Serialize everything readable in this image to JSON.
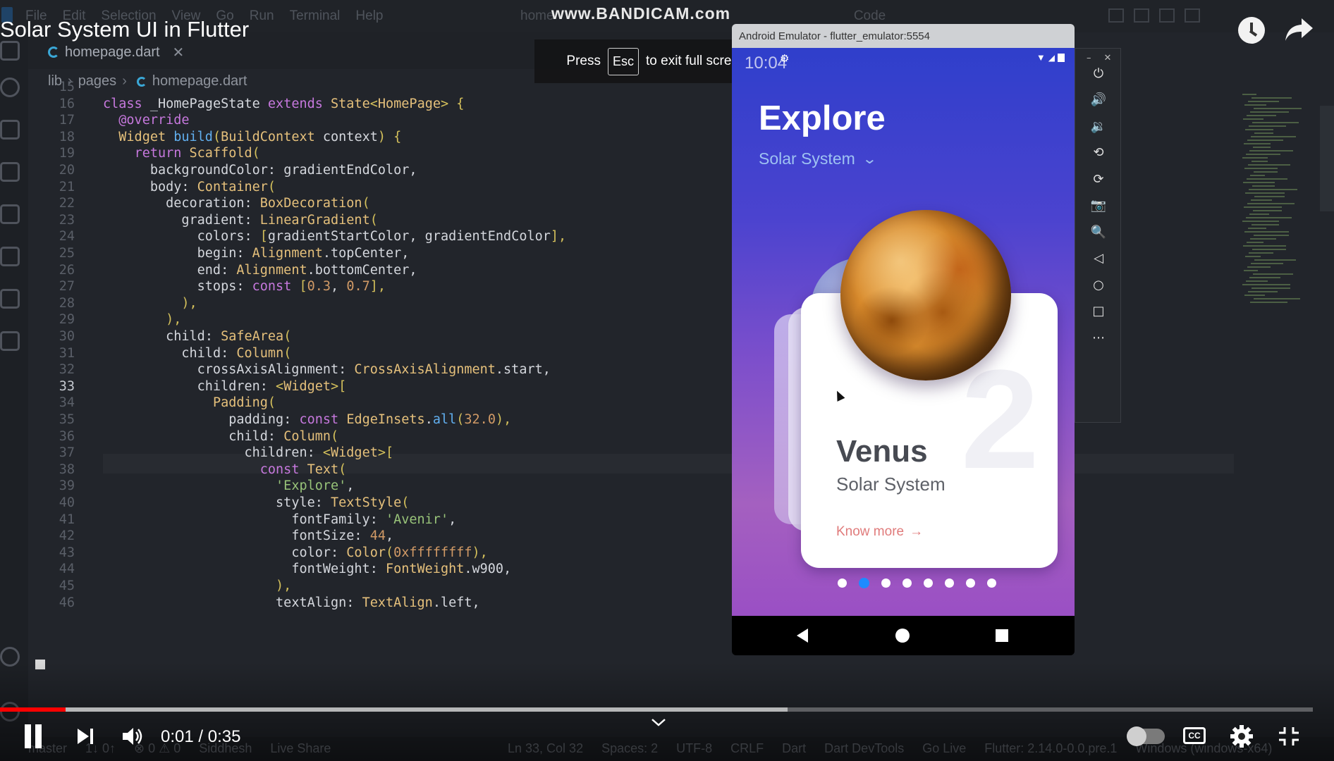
{
  "video": {
    "title": "Solar System UI in Flutter",
    "watermark": "www.BANDICAM.com",
    "fullscreen_hint": {
      "press": "Press",
      "key": "Esc",
      "rest": "to exit full screen"
    },
    "time_current": "0:01",
    "time_total": "0:35",
    "time_display": "0:01 / 0:35",
    "progress_fraction": 0.05,
    "buffered_fraction": 0.6
  },
  "vscode": {
    "menu": [
      "File",
      "Edit",
      "Selection",
      "View",
      "Go",
      "Run",
      "Terminal",
      "Help"
    ],
    "window_title": "home",
    "window_title_tail": "Code",
    "tab": {
      "label": "homepage.dart",
      "close": "✕"
    },
    "breadcrumb": [
      "lib",
      "pages",
      "homepage.dart"
    ],
    "status_left": [
      "master",
      "1↓ 0↑",
      "⊗ 0 ⚠ 0",
      "Siddhesh",
      "Live Share"
    ],
    "status_right": [
      "Ln 33, Col 32",
      "Spaces: 2",
      "UTF-8",
      "CRLF",
      "Dart",
      "Dart DevTools",
      "Go Live",
      "Flutter: 2.14.0-0.0.pre.1",
      "Windows (windows-x64)"
    ]
  },
  "code": {
    "active_line": 33,
    "lines": [
      {
        "n": 15,
        "t": ""
      },
      {
        "n": 16,
        "t": "class _HomePageState extends State<HomePage> {"
      },
      {
        "n": 17,
        "t": "  @override"
      },
      {
        "n": 18,
        "t": "  Widget build(BuildContext context) {"
      },
      {
        "n": 19,
        "t": "    return Scaffold("
      },
      {
        "n": 20,
        "t": "      backgroundColor: gradientEndColor,"
      },
      {
        "n": 21,
        "t": "      body: Container("
      },
      {
        "n": 22,
        "t": "        decoration: BoxDecoration("
      },
      {
        "n": 23,
        "t": "          gradient: LinearGradient("
      },
      {
        "n": 24,
        "t": "            colors: [gradientStartColor, gradientEndColor],"
      },
      {
        "n": 25,
        "t": "            begin: Alignment.topCenter,"
      },
      {
        "n": 26,
        "t": "            end: Alignment.bottomCenter,"
      },
      {
        "n": 27,
        "t": "            stops: const [0.3, 0.7],"
      },
      {
        "n": 28,
        "t": "          ),"
      },
      {
        "n": 29,
        "t": "        ),"
      },
      {
        "n": 30,
        "t": "        child: SafeArea("
      },
      {
        "n": 31,
        "t": "          child: Column("
      },
      {
        "n": 32,
        "t": "            crossAxisAlignment: CrossAxisAlignment.start,"
      },
      {
        "n": 33,
        "t": "            children: <Widget>["
      },
      {
        "n": 34,
        "t": "              Padding("
      },
      {
        "n": 35,
        "t": "                padding: const EdgeInsets.all(32.0),"
      },
      {
        "n": 36,
        "t": "                child: Column("
      },
      {
        "n": 37,
        "t": "                  children: <Widget>["
      },
      {
        "n": 38,
        "t": "                    const Text("
      },
      {
        "n": 39,
        "t": "                      'Explore',"
      },
      {
        "n": 40,
        "t": "                      style: TextStyle("
      },
      {
        "n": 41,
        "t": "                        fontFamily: 'Avenir',"
      },
      {
        "n": 42,
        "t": "                        fontSize: 44,"
      },
      {
        "n": 43,
        "t": "                        color: Color(0xffffffff),"
      },
      {
        "n": 44,
        "t": "                        fontWeight: FontWeight.w900,"
      },
      {
        "n": 45,
        "t": "                      ),"
      },
      {
        "n": 46,
        "t": "                      textAlign: TextAlign.left,"
      }
    ]
  },
  "emulator": {
    "window_title": "Android Emulator - flutter_emulator:5554",
    "clock": "10:04",
    "app": {
      "title": "Explore",
      "dropdown_value": "Solar System",
      "card": {
        "number": "2",
        "planet_name": "Venus",
        "planet_subtitle": "Solar System",
        "cta": "Know more",
        "cta_arrow": "→"
      },
      "page_count": 8,
      "active_page": 1
    },
    "toolbar": [
      "power",
      "volume-up",
      "volume-down",
      "rotate-left",
      "rotate-right",
      "camera",
      "zoom",
      "back",
      "home",
      "overview",
      "more"
    ],
    "toolbar_glyphs": [
      "⏻",
      "🔊",
      "🔉",
      "⟲",
      "⟳",
      "📷",
      "🔍",
      "◁",
      "○",
      "□",
      "⋯"
    ]
  },
  "colors": {
    "gradient_start": "#2f3fcb",
    "gradient_end": "#9a4fc4",
    "progress_played": "#ff0000",
    "cta": "#e07b7b",
    "active_dot": "#1e8bff"
  }
}
